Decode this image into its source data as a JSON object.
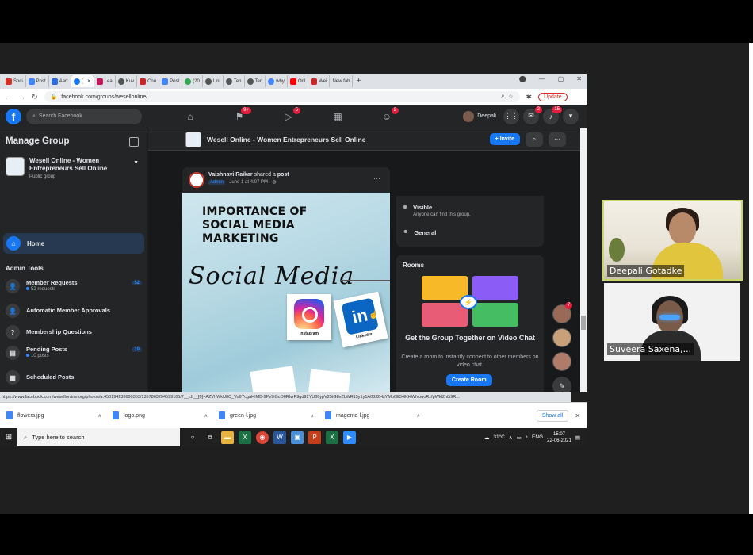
{
  "browser": {
    "tabs": [
      {
        "label": "Soci",
        "color": "#d93025"
      },
      {
        "label": "Post",
        "color": "#4285f4"
      },
      {
        "label": "Aart",
        "color": "#2d6cdf"
      },
      {
        "label": "(",
        "color": "#1877f2"
      },
      {
        "label": "Lea",
        "color": "#c2185b"
      },
      {
        "label": "Kuv",
        "color": "#555555"
      },
      {
        "label": "Cou",
        "color": "#c62828"
      },
      {
        "label": "Post",
        "color": "#4285f4"
      },
      {
        "label": "(20",
        "color": "#34a853"
      },
      {
        "label": "Uni",
        "color": "#555555"
      },
      {
        "label": "Ten",
        "color": "#555555"
      },
      {
        "label": "Ten",
        "color": "#555555"
      },
      {
        "label": "why",
        "color": "#4285f4"
      },
      {
        "label": "Onl",
        "color": "#ff0000"
      },
      {
        "label": "Wei",
        "color": "#c62828"
      },
      {
        "label": "New fab",
        "color": "#ffffff"
      }
    ],
    "url": "facebook.com/groups/wesellonline/",
    "update_label": "Update",
    "status_url": "https://www.facebook.com/wesellonline.org/photos/a.450194238699353/1357863294599105/?__cft__[0]=AZVhWkU8C_Vo6YcgaHIMB-9Pv9iGcO6RlvrP9gd92YU36ypV25tG8vZLWR15y1y1A08J2HsYMp0E34lKHWfvouoRzfpWkl2h8i9R..."
  },
  "fb_nav": {
    "search_placeholder": "Search Facebook",
    "badges": {
      "pages": "9+",
      "watch": "5",
      "groups": "2",
      "messenger": "2",
      "notifications": "15"
    },
    "user_name": "Deepali"
  },
  "sidebar": {
    "title": "Manage Group",
    "group_name": "Wesell Online - Women Entrepreneurs Sell Online",
    "group_privacy": "Public group",
    "home_label": "Home",
    "section_label": "Admin Tools",
    "items": [
      {
        "label": "Member Requests",
        "sub": "52 requests",
        "count": "52"
      },
      {
        "label": "Automatic Member Approvals",
        "sub": "",
        "count": ""
      },
      {
        "label": "Membership Questions",
        "sub": "",
        "count": ""
      },
      {
        "label": "Pending Posts",
        "sub": "10 posts",
        "count": "10"
      },
      {
        "label": "Scheduled Posts",
        "sub": "",
        "count": ""
      }
    ]
  },
  "group_bar": {
    "title": "Wesell Online - Women Entrepreneurs Sell Online",
    "invite_label": "+ Invite"
  },
  "post": {
    "author": "Vaishnavi Raikar",
    "action": "shared a",
    "action_target": "post",
    "role": "Admin",
    "time": "June 1 at 4:07 PM",
    "image_title": "IMPORTANCE OF SOCIAL MEDIA MARKETING",
    "image_script": "Social Media",
    "instagram_caption": "Instagram",
    "linkedin_caption": "LinkedIn"
  },
  "about": {
    "visible_title": "Visible",
    "visible_sub": "Anyone can find this group.",
    "general_title": "General"
  },
  "rooms": {
    "title": "Rooms",
    "heading": "Get the Group Together on Video Chat",
    "body": "Create a room to instantly connect to other members on video chat.",
    "button": "Create Room"
  },
  "contacts_badge": "7",
  "downloads": {
    "files": [
      "flowers.jpg",
      "logo.png",
      "green-l.jpg",
      "magenta-l.jpg"
    ],
    "show_all": "Show all"
  },
  "taskbar": {
    "search_placeholder": "Type here to search",
    "weather": "31°C",
    "language": "ENG",
    "time": "15:07",
    "date": "22-06-2021"
  },
  "video_call": {
    "participants": [
      "Deepali Gotadke",
      "Suveera Saxena,..."
    ]
  }
}
